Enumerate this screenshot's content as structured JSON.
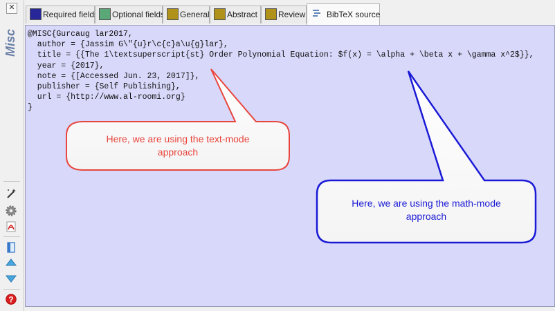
{
  "sidebar": {
    "close_glyph": "✕",
    "entry_type_label": "Misc",
    "tools": [
      {
        "icon": "magic-wand-icon"
      },
      {
        "icon": "gear-icon"
      },
      {
        "icon": "pdf-icon"
      },
      {
        "icon": "document-icon"
      },
      {
        "icon": "arrow-up-icon"
      },
      {
        "icon": "arrow-down-icon"
      },
      {
        "icon": "help-icon"
      }
    ],
    "help_glyph": "?"
  },
  "tabs": [
    {
      "label": "Required fields",
      "color": "#27279a"
    },
    {
      "label": "Optional fields",
      "color": "#5aa878"
    },
    {
      "label": "General",
      "color": "#b0921a"
    },
    {
      "label": "Abstract",
      "color": "#b0921a"
    },
    {
      "label": "Review",
      "color": "#b0921a"
    },
    {
      "label": "BibTeX source",
      "icon": "source-icon",
      "active": true
    }
  ],
  "editor": {
    "source": "@MISC{Gurcaug lar2017,\n  author = {Jassim G\\\"{u}r\\c{c}a\\u{g}lar},\n  title = {{The 1\\textsuperscript{st} Order Polynomial Equation: $f(x) = \\alpha + \\beta x + \\gamma x^2$}},\n  year = {2017},\n  note = {[Accessed Jun. 23, 2017]},\n  publisher = {Self Publishing},\n  url = {http://www.al-roomi.org}\n}",
    "background": "#d8d8fa"
  },
  "callouts": {
    "text_mode": {
      "line1": "Here, we are using the text-mode",
      "line2": "approach",
      "color": "#e8453c"
    },
    "math_mode": {
      "line1": "Here, we are using the math-mode",
      "line2": "approach",
      "color": "#1a1ad6"
    }
  }
}
